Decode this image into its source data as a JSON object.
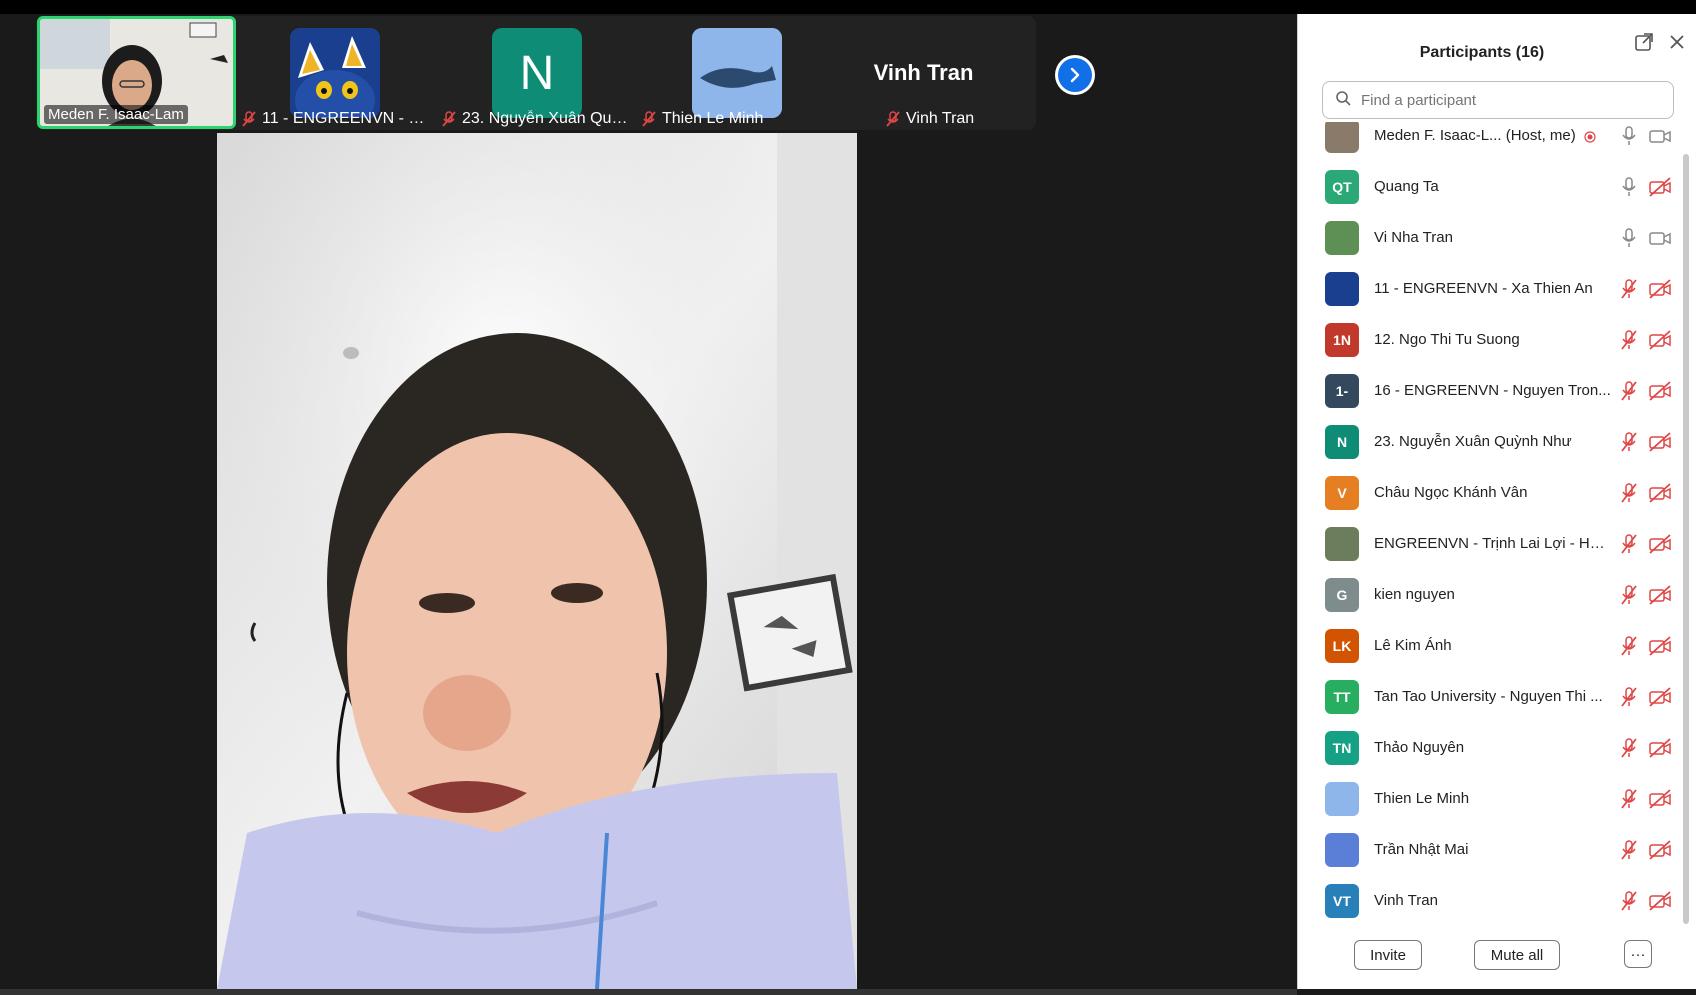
{
  "self_tile": {
    "name": "Meden F. Isaac-Lam"
  },
  "strip_tiles": [
    {
      "name": "11 - ENGREENVN - Xa ...",
      "avatar_text": "",
      "avatar_color": "#1b3f8f"
    },
    {
      "name": "23. Nguyễn Xuân Quỳ...",
      "avatar_text": "N",
      "avatar_color": "#0f8c76"
    },
    {
      "name": "Thien Le Minh",
      "avatar_text": "",
      "avatar_color": "#8fb6ea"
    },
    {
      "name": "Vinh Tran",
      "display_text": "Vinh Tran"
    }
  ],
  "next_icon": "chevron-right-icon",
  "panel": {
    "title": "Participants (16)",
    "search_placeholder": "Find a participant",
    "participants": [
      {
        "name": "Meden F. Isaac-L...  (Host, me)",
        "initials": "",
        "color": "#8a7a6a",
        "mic": "on",
        "cam": "on",
        "recording": true
      },
      {
        "name": "Quang Ta",
        "initials": "QT",
        "color": "#2aa876",
        "mic": "on",
        "cam": "off"
      },
      {
        "name": "Vi Nha Tran",
        "initials": "",
        "color": "#5e8f54",
        "mic": "on",
        "cam": "on"
      },
      {
        "name": "11 - ENGREENVN - Xa Thien An",
        "initials": "",
        "color": "#1b3f8f",
        "mic": "off",
        "cam": "off"
      },
      {
        "name": "12. Ngo Thi Tu Suong",
        "initials": "1N",
        "color": "#c0392b",
        "mic": "off",
        "cam": "off"
      },
      {
        "name": "16 - ENGREENVN - Nguyen Tron...",
        "initials": "1-",
        "color": "#34495e",
        "mic": "off",
        "cam": "off"
      },
      {
        "name": "23. Nguyễn Xuân Quỳnh Như",
        "initials": "N",
        "color": "#0f8c76",
        "mic": "off",
        "cam": "off"
      },
      {
        "name": "Châu Ngọc Khánh Vân",
        "initials": "V",
        "color": "#e67e22",
        "mic": "off",
        "cam": "off"
      },
      {
        "name": "ENGREENVN - Trịnh Lai Lợi - HU...",
        "initials": "",
        "color": "#6b7d5a",
        "mic": "off",
        "cam": "off"
      },
      {
        "name": "kien nguyen",
        "initials": "G",
        "color": "#7f8c8d",
        "mic": "off",
        "cam": "off"
      },
      {
        "name": "Lê Kim Ánh",
        "initials": "LK",
        "color": "#d35400",
        "mic": "off",
        "cam": "off"
      },
      {
        "name": "Tan Tao University - Nguyen Thi ...",
        "initials": "TT",
        "color": "#27ae60",
        "mic": "off",
        "cam": "off"
      },
      {
        "name": "Thảo Nguyên",
        "initials": "TN",
        "color": "#16a085",
        "mic": "off",
        "cam": "off"
      },
      {
        "name": "Thien Le Minh",
        "initials": "",
        "color": "#8fb6ea",
        "mic": "off",
        "cam": "off"
      },
      {
        "name": "Trần Nhật Mai",
        "initials": "",
        "color": "#5b7fd6",
        "mic": "off",
        "cam": "off"
      },
      {
        "name": "Vinh Tran",
        "initials": "VT",
        "color": "#2980b9",
        "mic": "off",
        "cam": "off"
      }
    ],
    "invite_label": "Invite",
    "mute_all_label": "Mute all",
    "more_label": "···"
  }
}
